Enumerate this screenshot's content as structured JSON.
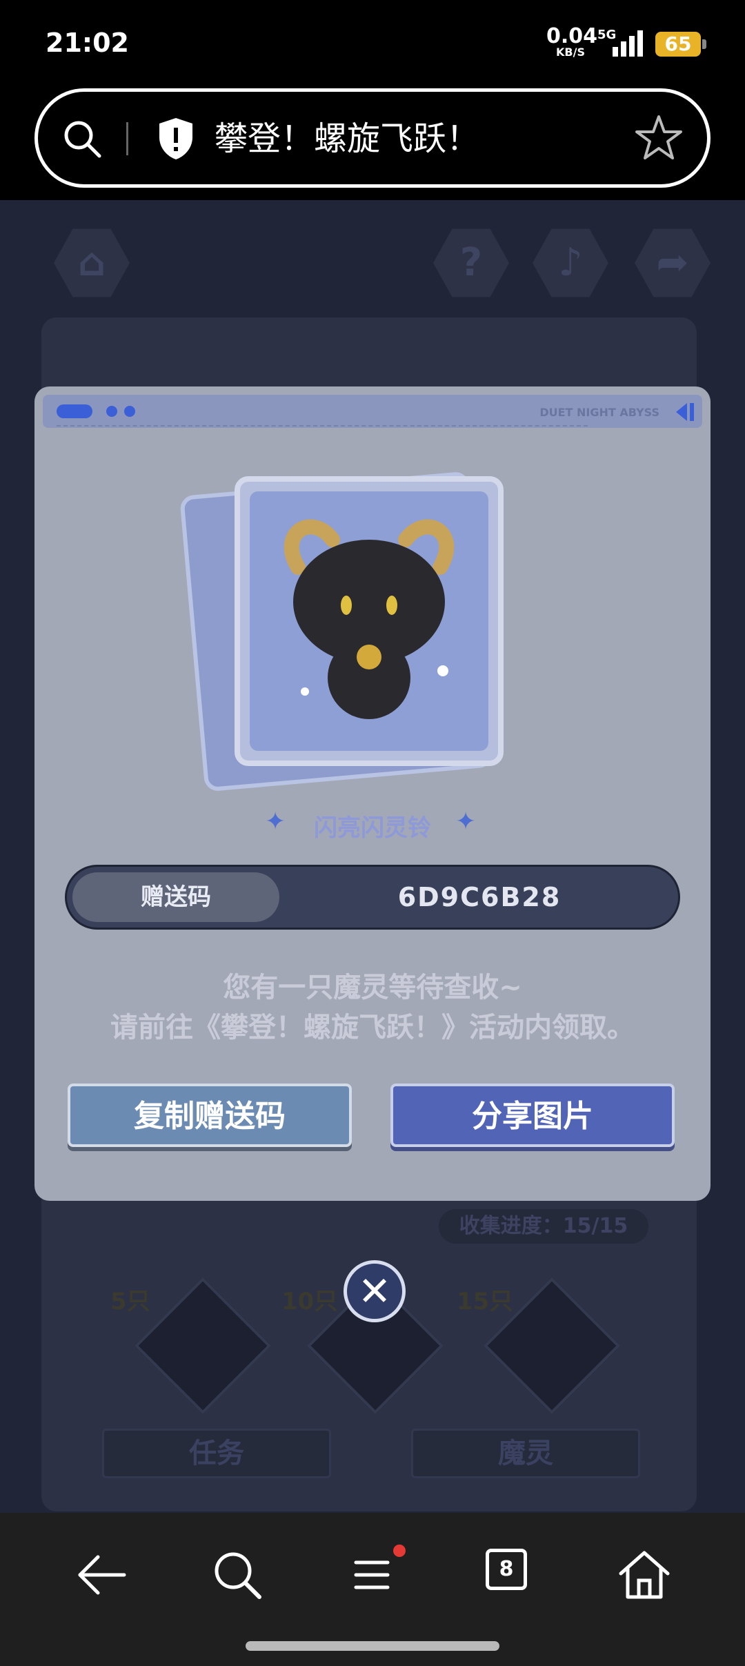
{
  "status_bar": {
    "time": "21:02",
    "net_speed_value": "0.04",
    "net_speed_unit": "KB/S",
    "network": "5G",
    "battery": "65"
  },
  "browser": {
    "page_title": "攀登！螺旋飞跃！"
  },
  "game_bg": {
    "progress_text": "收集进度：15/15",
    "milestones": [
      "5只",
      "10只",
      "15只"
    ],
    "tab_task": "任务",
    "tab_spirit": "魔灵"
  },
  "modal": {
    "header_text": "DUET NIGHT ABYSS",
    "item_name": "闪亮闪灵铃",
    "code_label": "赠送码",
    "code_value": "6D9C6B28",
    "message_line1": "您有一只魔灵等待查收~",
    "message_line2": "请前往《攀登！螺旋飞跃！》活动内领取。",
    "copy_button": "复制赠送码",
    "share_button": "分享图片"
  },
  "nav": {
    "tab_count": "8"
  },
  "colors": {
    "modal_bg": "#a3a8b6",
    "accent_blue": "#5164b6",
    "copy_blue": "#6c8bb3",
    "battery": "#e8b327"
  }
}
